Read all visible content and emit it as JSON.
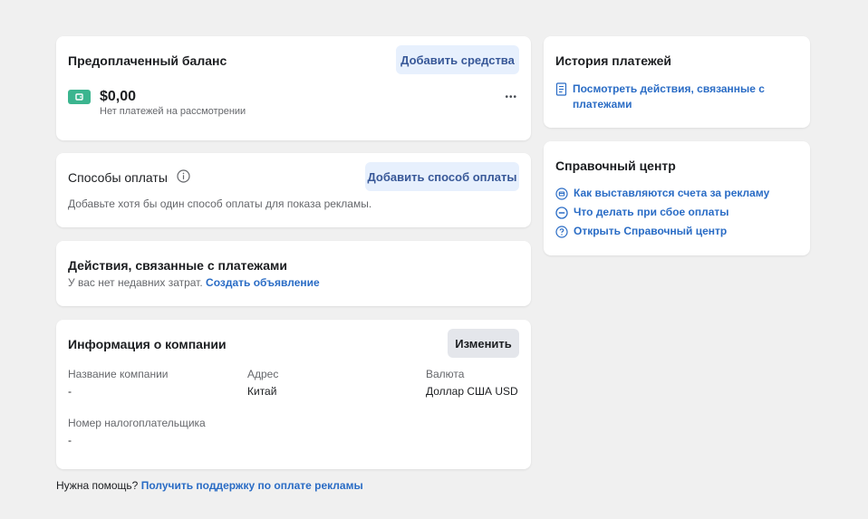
{
  "balance": {
    "title": "Предоплаченный баланс",
    "add_funds_label": "Добавить средства",
    "amount": "$0,00",
    "pending_text": "Нет платежей на рассмотрении",
    "more_label": "•••"
  },
  "payment_methods": {
    "title": "Способы оплаты",
    "add_method_label": "Добавить способ оплаты",
    "description": "Добавьте хотя бы один способ оплаты для показа рекламы."
  },
  "activity": {
    "title": "Действия, связанные с платежами",
    "text": "У вас нет недавних затрат.",
    "create_ad_link": "Создать объявление"
  },
  "company": {
    "title": "Информация о компании",
    "edit_label": "Изменить",
    "fields": [
      {
        "label": "Название компании",
        "value": "-"
      },
      {
        "label": "Адрес",
        "value": "Китай"
      },
      {
        "label": "Валюта",
        "value": "Доллар США USD"
      },
      {
        "label": "Номер налогоплательщика",
        "value": "-"
      }
    ]
  },
  "help": {
    "text": "Нужна помощь?",
    "link": "Получить поддержку по оплате рекламы"
  },
  "history": {
    "title": "История платежей",
    "link": "Посмотреть действия, связанные с платежами"
  },
  "help_center": {
    "title": "Справочный центр",
    "links": [
      {
        "icon": "billing-icon",
        "label": "Как выставляются счета за рекламу"
      },
      {
        "icon": "minus-circle-icon",
        "label": "Что делать при сбое оплаты"
      },
      {
        "icon": "question-circle-icon",
        "label": "Открыть Справочный центр"
      }
    ]
  },
  "colors": {
    "background": "#f0f0f0",
    "card": "#ffffff",
    "link": "#2a6cc5",
    "soft_button": "#e7f0fd",
    "gray_button": "#e4e6eb",
    "wallet_icon": "#3bb58f"
  }
}
